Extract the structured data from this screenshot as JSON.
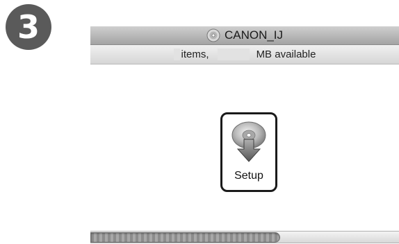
{
  "step": {
    "number": "3"
  },
  "window": {
    "title": "CANON_IJ",
    "status": {
      "items_label": "items,",
      "available_label": "MB available"
    }
  },
  "items": [
    {
      "label": "Setup",
      "icon": "setup-disc-icon"
    }
  ],
  "scrollbar": {
    "thumb_fraction": 0.61
  },
  "colors": {
    "badge": "#5a5a5a",
    "selection_outline": "#1a1a1a",
    "titlebar": "#b8b8b8"
  }
}
